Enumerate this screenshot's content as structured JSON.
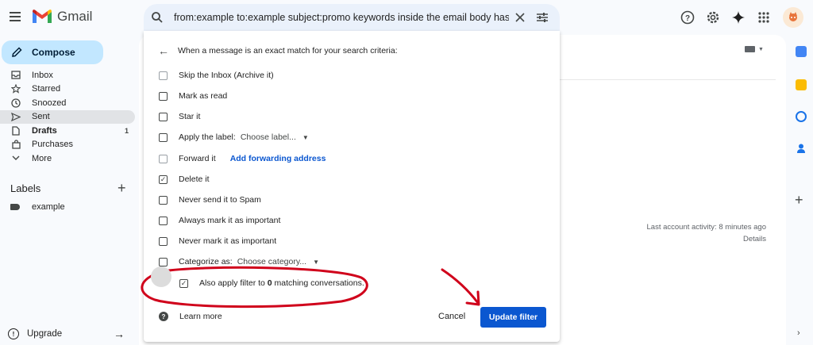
{
  "app": {
    "name": "Gmail"
  },
  "search": {
    "query": "from:example to:example subject:promo keywords inside the email body has:at"
  },
  "sidebar": {
    "compose_label": "Compose",
    "items": [
      {
        "label": "Inbox",
        "icon": "inbox-icon"
      },
      {
        "label": "Starred",
        "icon": "star-icon"
      },
      {
        "label": "Snoozed",
        "icon": "clock-icon"
      },
      {
        "label": "Sent",
        "icon": "send-icon"
      },
      {
        "label": "Drafts",
        "icon": "draft-icon",
        "count": "1"
      },
      {
        "label": "Purchases",
        "icon": "shopping-bag-icon"
      },
      {
        "label": "More",
        "icon": "chevron-down-icon"
      }
    ],
    "labels_header": "Labels",
    "labels": [
      "example"
    ],
    "upgrade_label": "Upgrade"
  },
  "filter": {
    "title": "When a message is an exact match for your search criteria:",
    "options": [
      {
        "label": "Skip the Inbox (Archive it)",
        "checked": false
      },
      {
        "label": "Mark as read",
        "checked": false
      },
      {
        "label": "Star it",
        "checked": false
      },
      {
        "label": "Apply the label:",
        "checked": false,
        "dropdown": "Choose label..."
      },
      {
        "label": "Forward it",
        "checked": false,
        "link": "Add forwarding address"
      },
      {
        "label": "Delete it",
        "checked": true
      },
      {
        "label": "Never send it to Spam",
        "checked": false
      },
      {
        "label": "Always mark it as important",
        "checked": false
      },
      {
        "label": "Never mark it as important",
        "checked": false
      },
      {
        "label": "Categorize as:",
        "checked": false,
        "dropdown": "Choose category..."
      }
    ],
    "also_apply": {
      "prefix": "Also apply filter to ",
      "count": "0",
      "suffix": " matching conversations.",
      "checked": true
    },
    "learn_more": "Learn more",
    "cancel": "Cancel",
    "update": "Update filter"
  },
  "activity": {
    "line1": "Last account activity: 8 minutes ago",
    "details": "Details"
  },
  "colors": {
    "accent": "#0b57d0",
    "compose": "#c2e7ff",
    "annotation": "#d0021b"
  }
}
